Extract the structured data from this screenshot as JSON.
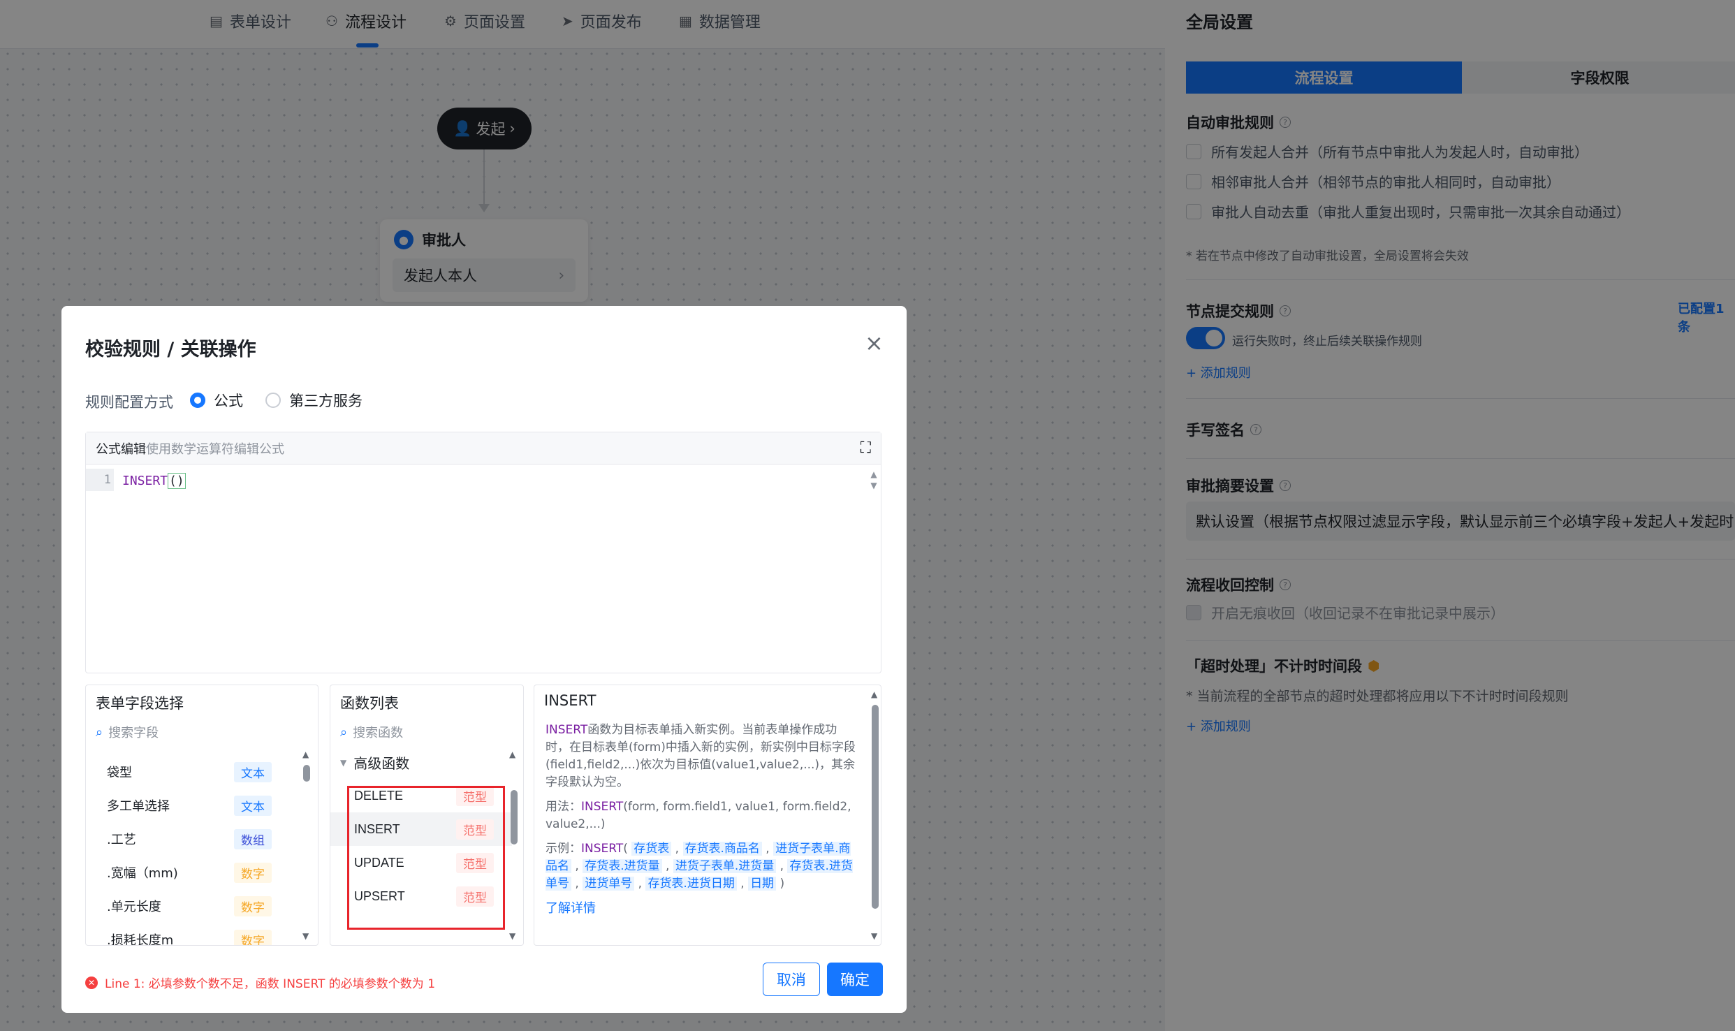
{
  "nav": {
    "tabs": [
      {
        "label": "表单设计",
        "icon": "form-icon"
      },
      {
        "label": "流程设计",
        "icon": "flow-icon"
      },
      {
        "label": "页面设置",
        "icon": "gear-icon"
      },
      {
        "label": "页面发布",
        "icon": "send-icon"
      },
      {
        "label": "数据管理",
        "icon": "table-icon"
      }
    ],
    "active": "流程设计"
  },
  "flow": {
    "start": "发起",
    "approver_title": "审批人",
    "approver_value": "发起人本人"
  },
  "panel": {
    "title": "全局设置",
    "seg": [
      "流程设置",
      "字段权限"
    ],
    "auto_approve": {
      "title": "自动审批规则",
      "options": [
        "所有发起人合并（所有节点中审批人为发起人时，自动审批）",
        "相邻审批人合并（相邻节点的审批人相同时，自动审批）",
        "审批人自动去重（审批人重复出现时，只需审批一次其余自动通过）"
      ],
      "note": "* 若在节点中修改了自动审批设置，全局设置将会失效"
    },
    "submit_rule": {
      "title": "节点提交规则",
      "configured": "已配置1条",
      "switch_label": "运行失败时，终止后续关联操作规则",
      "add": "+ 添加规则"
    },
    "signature": {
      "title": "手写签名"
    },
    "summary": {
      "title": "审批摘要设置",
      "value": "默认设置（根据节点权限过滤显示字段，默认显示前三个必填字段+发起人+发起时间"
    },
    "recall": {
      "title": "流程收回控制",
      "option": "开启无痕收回（收回记录不在审批记录中展示）"
    },
    "timeout": {
      "title": "「超时处理」不计时时间段",
      "note": "* 当前流程的全部节点的超时处理都将应用以下不计时时间段规则",
      "add": "+ 添加规则"
    }
  },
  "modal": {
    "title": "校验规则 / 关联操作",
    "mode_label": "规则配置方式",
    "mode_options": [
      "公式",
      "第三方服务"
    ],
    "editor_title": "公式编辑",
    "editor_placeholder": "使用数学运算符编辑公式",
    "line_no": "1",
    "code_fn": "INSERT",
    "code_paren": "()",
    "fields": {
      "title": "表单字段选择",
      "search": "搜索字段",
      "rows": [
        {
          "name": "袋型",
          "type": "文本"
        },
        {
          "name": "多工单选择",
          "type": "文本"
        },
        {
          "name": ".工艺",
          "type": "数组"
        },
        {
          "name": ".宽幅（mm)",
          "type": "数字"
        },
        {
          "name": ".单元长度",
          "type": "数字"
        },
        {
          "name": ".损耗长度m",
          "type": "数字"
        }
      ]
    },
    "functions": {
      "title": "函数列表",
      "search": "搜索函数",
      "group": "高级函数",
      "items": [
        {
          "name": "DELETE",
          "tag": "范型"
        },
        {
          "name": "INSERT",
          "tag": "范型"
        },
        {
          "name": "UPDATE",
          "tag": "范型"
        },
        {
          "name": "UPSERT",
          "tag": "范型"
        }
      ]
    },
    "detail": {
      "title": "INSERT",
      "desc_fn": "INSERT",
      "desc": "函数为目标表单插入新实例。当前表单操作成功时，在目标表单(form)中插入新的实例，新实例中目标字段(field1,field2,...)依次为目标值(value1,value2,...)，其余字段默认为空。",
      "usage_label": "用法：",
      "usage_fn": "INSERT",
      "usage": "(form, form.field1, value1, form.field2, value2,...)",
      "example_label": "示例：",
      "example_fn": "INSERT",
      "example_args": [
        "存货表",
        "存货表.商品名",
        "进货子表单.商品名",
        "存货表.进货量",
        "进货子表单.进货量",
        "存货表.进货单号",
        "进货单号",
        "存货表.进货日期",
        "日期"
      ],
      "more": "了解详情"
    },
    "error": "Line 1: 必填参数个数不足，函数 INSERT 的必填参数个数为 1",
    "cancel": "取消",
    "confirm": "确定"
  }
}
